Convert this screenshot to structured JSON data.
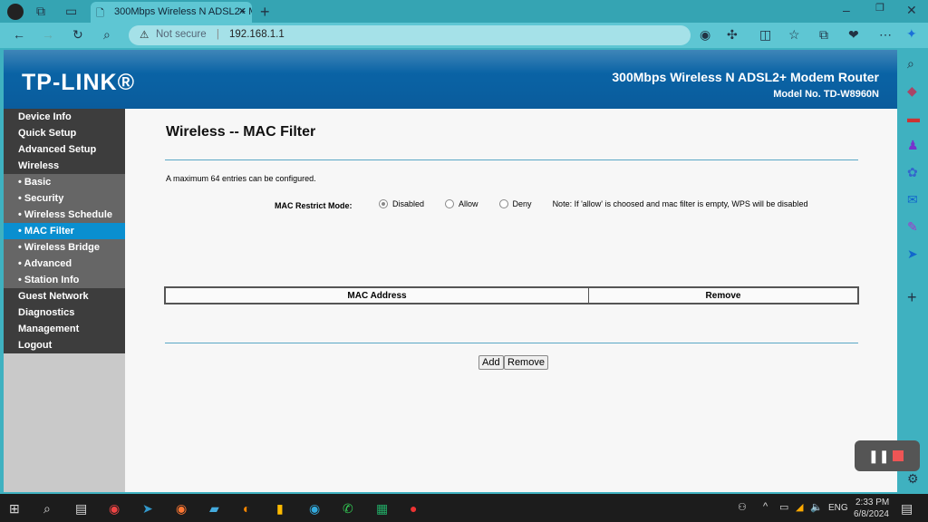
{
  "browser": {
    "tab_title": "300Mbps Wireless N ADSL2+ Mo",
    "security": "Not secure",
    "url": "192.168.1.1"
  },
  "header": {
    "logo": "TP-LINK®",
    "product": "300Mbps Wireless N ADSL2+ Modem Router",
    "model": "Model No. TD-W8960N"
  },
  "sidebar": {
    "items": [
      {
        "label": "Device Info",
        "level": 0
      },
      {
        "label": "Quick Setup",
        "level": 0
      },
      {
        "label": "Advanced Setup",
        "level": 0
      },
      {
        "label": "Wireless",
        "level": 0
      },
      {
        "label": "• Basic",
        "level": 1
      },
      {
        "label": "• Security",
        "level": 1
      },
      {
        "label": "• Wireless Schedule",
        "level": 1
      },
      {
        "label": "• MAC Filter",
        "level": 1,
        "active": true
      },
      {
        "label": "• Wireless Bridge",
        "level": 1
      },
      {
        "label": "• Advanced",
        "level": 1
      },
      {
        "label": "• Station Info",
        "level": 1
      },
      {
        "label": "Guest Network",
        "level": 0
      },
      {
        "label": "Diagnostics",
        "level": 0
      },
      {
        "label": "Management",
        "level": 0
      },
      {
        "label": "Logout",
        "level": 0
      }
    ]
  },
  "main": {
    "title": "Wireless -- MAC Filter",
    "info": "A maximum 64 entries can be configured.",
    "mode_label": "MAC Restrict Mode:",
    "modes": [
      "Disabled",
      "Allow",
      "Deny"
    ],
    "selected_mode": "Disabled",
    "note": "Note: If 'allow' is choosed and mac filter is empty, WPS will be disabled",
    "table_headers": [
      "MAC Address",
      "Remove"
    ],
    "add_button": "Add",
    "remove_button": "Remove"
  },
  "taskbar": {
    "lang": "ENG",
    "time": "2:33 PM",
    "date": "6/8/2024"
  }
}
